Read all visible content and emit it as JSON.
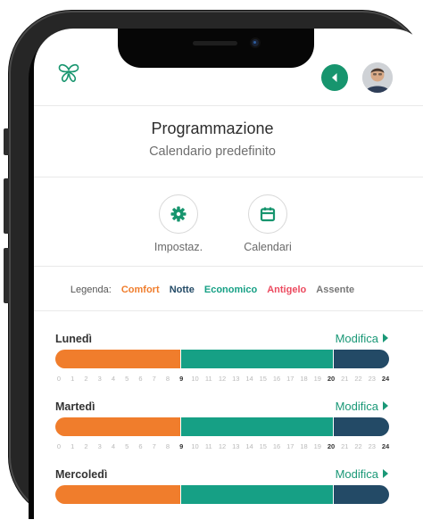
{
  "app": {
    "title": "Programmazione",
    "subtitle": "Calendario predefinito"
  },
  "header": {
    "logo_icon": "butterfly-logo-icon",
    "back_icon": "chevron-left-icon",
    "accent_color": "#17956e"
  },
  "actions": [
    {
      "label": "Impostaz.",
      "icon": "gear-icon"
    },
    {
      "label": "Calendari",
      "icon": "calendar-icon"
    }
  ],
  "legend": {
    "label": "Legenda:",
    "items": [
      {
        "name": "Comfort",
        "color": "#f07d2c"
      },
      {
        "name": "Notte",
        "color": "#234a66"
      },
      {
        "name": "Economico",
        "color": "#16a085"
      },
      {
        "name": "Antigelo",
        "color": "#ec4a5f"
      },
      {
        "name": "Assente",
        "color": "#777777"
      }
    ]
  },
  "edit_label": "Modifica",
  "hours_ticks": [
    "0",
    "1",
    "2",
    "3",
    "4",
    "5",
    "6",
    "7",
    "8",
    "9",
    "10",
    "11",
    "12",
    "13",
    "14",
    "15",
    "16",
    "17",
    "18",
    "19",
    "20",
    "21",
    "22",
    "23",
    "24"
  ],
  "highlight_hours": [
    "9",
    "20",
    "24"
  ],
  "days": [
    {
      "name": "Lunedì",
      "segments": [
        {
          "mode": "Comfort",
          "start": 0,
          "end": 9
        },
        {
          "mode": "Economico",
          "start": 9,
          "end": 20
        },
        {
          "mode": "Notte",
          "start": 20,
          "end": 24
        }
      ]
    },
    {
      "name": "Martedì",
      "segments": [
        {
          "mode": "Comfort",
          "start": 0,
          "end": 9
        },
        {
          "mode": "Economico",
          "start": 9,
          "end": 20
        },
        {
          "mode": "Notte",
          "start": 20,
          "end": 24
        }
      ]
    },
    {
      "name": "Mercoledì",
      "segments": [
        {
          "mode": "Comfort",
          "start": 0,
          "end": 9
        },
        {
          "mode": "Economico",
          "start": 9,
          "end": 20
        },
        {
          "mode": "Notte",
          "start": 20,
          "end": 24
        }
      ]
    }
  ]
}
